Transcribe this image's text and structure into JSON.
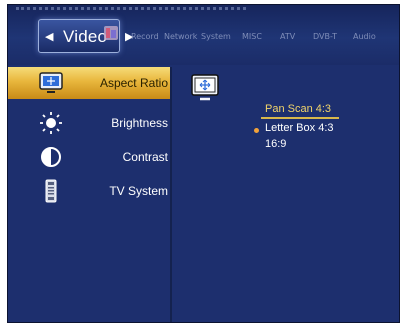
{
  "current_tab": {
    "label": "Video"
  },
  "tabs": [
    "Record",
    "Network",
    "System",
    "MISC",
    "ATV",
    "DVB-T",
    "Audio"
  ],
  "menu": [
    {
      "label": "Aspect Ratio",
      "icon": "monitor-icon",
      "selected": true
    },
    {
      "label": "Brightness",
      "icon": "sun-icon",
      "selected": false
    },
    {
      "label": "Contrast",
      "icon": "contrast-icon",
      "selected": false
    },
    {
      "label": "TV System",
      "icon": "remote-icon",
      "selected": false
    }
  ],
  "options": [
    {
      "label": "Pan Scan 4:3",
      "highlighted": true,
      "active": false
    },
    {
      "label": "Letter Box 4:3",
      "highlighted": false,
      "active": true
    },
    {
      "label": "16:9",
      "highlighted": false,
      "active": false
    }
  ],
  "colors": {
    "background": "#1d2f6e",
    "selection": "#e8b63c",
    "highlight_text": "#f1d46a",
    "bullet": "#f2a23a"
  }
}
